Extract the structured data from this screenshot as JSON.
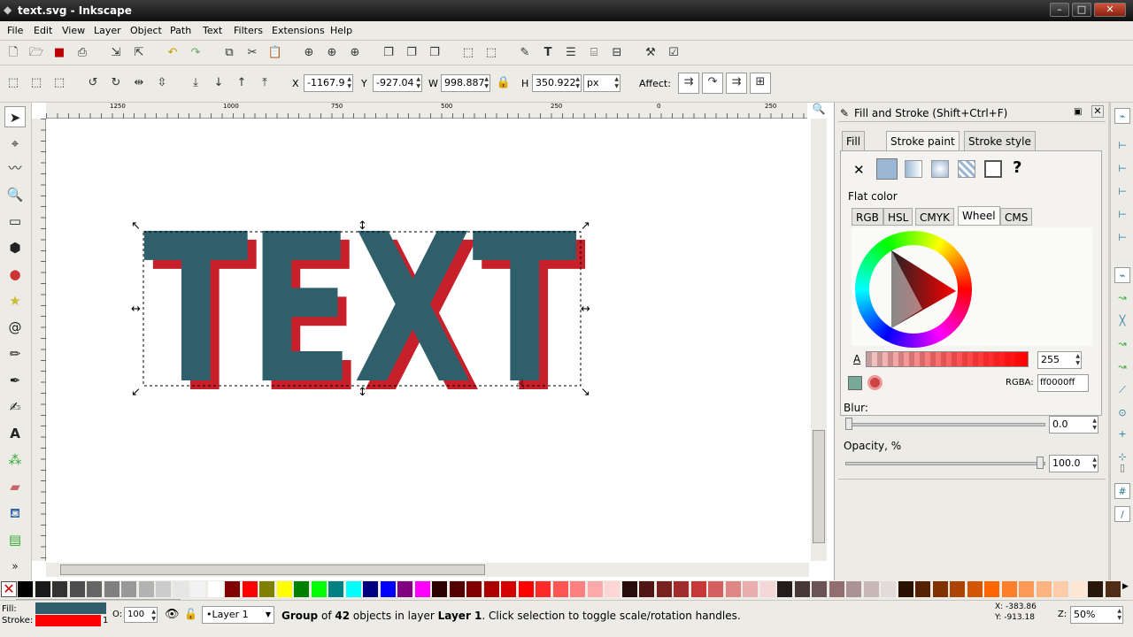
{
  "window": {
    "title": "text.svg - Inkscape",
    "min": "–",
    "max": "□",
    "close": "✕"
  },
  "menu": [
    "File",
    "Edit",
    "View",
    "Layer",
    "Object",
    "Path",
    "Text",
    "Filters",
    "Extensions",
    "Help"
  ],
  "select_toolbar": {
    "x_label": "X",
    "x_value": "-1167.9",
    "y_label": "Y",
    "y_value": "-927.04",
    "w_label": "W",
    "w_value": "998.887",
    "h_label": "H",
    "h_value": "350.922",
    "unit": "px",
    "affect_label": "Affect:"
  },
  "ruler": {
    "ticks": [
      "1250",
      "1000",
      "750",
      "500",
      "250",
      "0",
      "250"
    ]
  },
  "canvas": {
    "text": "TEXT",
    "fill_color": "#2e5f6b",
    "shadow_color": "#c8202a"
  },
  "fill_stroke": {
    "title": "Fill and Stroke (Shift+Ctrl+F)",
    "tabs": [
      "Fill",
      "Stroke paint",
      "Stroke style"
    ],
    "flat_color_label": "Flat color",
    "color_modes": [
      "RGB",
      "HSL",
      "CMYK",
      "Wheel",
      "CMS"
    ],
    "alpha_label": "A",
    "alpha_value": "255",
    "rgba_label": "RGBA:",
    "rgba_value": "ff0000ff",
    "blur_label": "Blur:",
    "blur_value": "0.0",
    "opacity_label": "Opacity, %",
    "opacity_value": "100.0",
    "unknown_paint": "?"
  },
  "palette_colors": [
    "#000000",
    "#1a1a1a",
    "#333333",
    "#4d4d4d",
    "#666666",
    "#808080",
    "#999999",
    "#b3b3b3",
    "#cccccc",
    "#e6e6e6",
    "#f2f2f2",
    "#ffffff",
    "#800000",
    "#ff0000",
    "#808000",
    "#ffff00",
    "#008000",
    "#00ff00",
    "#008080",
    "#00ffff",
    "#000080",
    "#0000ff",
    "#800080",
    "#ff00ff",
    "#2b0000",
    "#550000",
    "#800000",
    "#aa0000",
    "#d40000",
    "#ff0000",
    "#ff2a2a",
    "#ff5555",
    "#ff8080",
    "#ffaaaa",
    "#ffd5d5",
    "#280b0b",
    "#501616",
    "#782121",
    "#a02c2c",
    "#c83737",
    "#d35f5f",
    "#de8787",
    "#e9afaf",
    "#f4d7d7",
    "#241c1c",
    "#483737",
    "#6c5353",
    "#916f6f",
    "#ac9393",
    "#c8b7b7",
    "#e3dbdb",
    "#2b1100",
    "#552200",
    "#803300",
    "#aa4400",
    "#d45500",
    "#ff6600",
    "#ff7f2a",
    "#ff9955",
    "#ffb380",
    "#ffccaa",
    "#ffe6d5",
    "#28170b",
    "#502d16"
  ],
  "status": {
    "fill_label": "Fill:",
    "stroke_label": "Stroke:",
    "stroke_width": "1",
    "opacity_label": "O:",
    "opacity_value": "100",
    "layer": "•Layer 1",
    "message_bold1": "Group",
    "message_mid": " of ",
    "message_bold2": "42",
    "message_mid2": " objects in layer ",
    "message_bold3": "Layer 1",
    "message_end": ". Click selection to toggle scale/rotation handles.",
    "cursor_x": "X: -383.86",
    "cursor_y": "Y: -913.18",
    "zoom_label": "Z:",
    "zoom_value": "50%",
    "fill_color": "#2e5f6b",
    "stroke_color": "#ff0000"
  }
}
